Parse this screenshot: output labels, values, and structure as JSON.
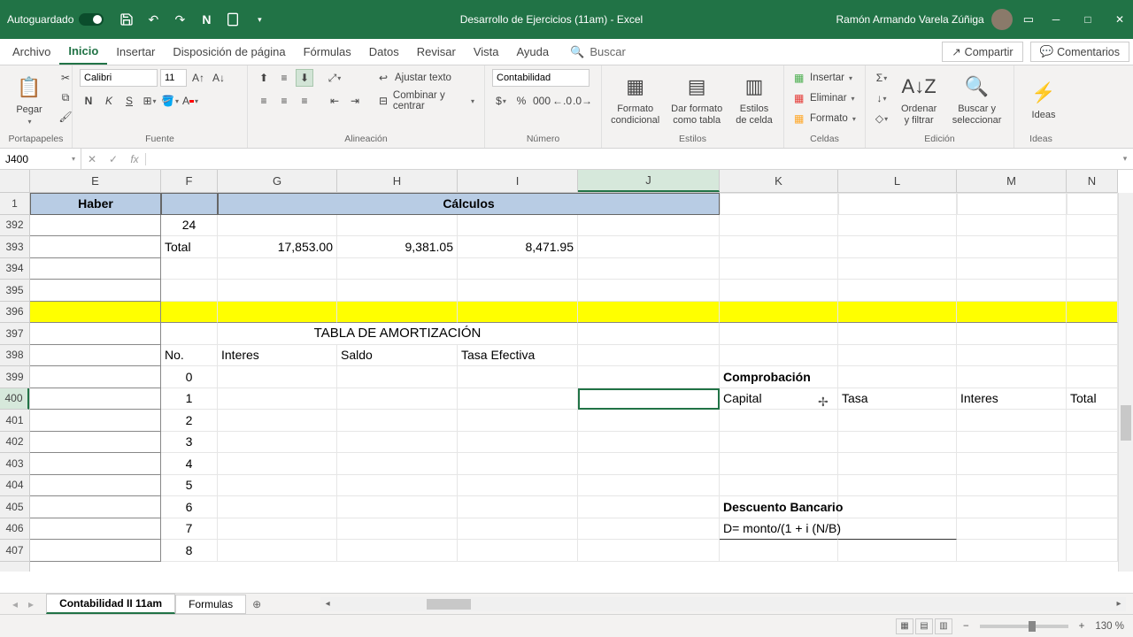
{
  "titlebar": {
    "autosave": "Autoguardado",
    "document": "Desarrollo de Ejercicios (11am)  -  Excel",
    "user": "Ramón Armando Varela Zúñiga"
  },
  "tabs": {
    "items": [
      "Archivo",
      "Inicio",
      "Insertar",
      "Disposición de página",
      "Fórmulas",
      "Datos",
      "Revisar",
      "Vista",
      "Ayuda"
    ],
    "active_index": 1,
    "search": "Buscar",
    "share": "Compartir",
    "comments": "Comentarios"
  },
  "ribbon": {
    "clipboard": {
      "paste": "Pegar",
      "label": "Portapapeles"
    },
    "font": {
      "name": "Calibri",
      "size": "11",
      "label": "Fuente"
    },
    "alignment": {
      "wrap": "Ajustar texto",
      "merge": "Combinar y centrar",
      "label": "Alineación"
    },
    "number": {
      "format": "Contabilidad",
      "label": "Número"
    },
    "styles": {
      "cond": "Formato condicional",
      "table": "Dar formato como tabla",
      "cell": "Estilos de celda",
      "label": "Estilos"
    },
    "cells": {
      "insert": "Insertar",
      "delete": "Eliminar",
      "format": "Formato",
      "label": "Celdas"
    },
    "editing": {
      "sort": "Ordenar y filtrar",
      "find": "Buscar y seleccionar",
      "label": "Edición"
    },
    "ideas": {
      "btn": "Ideas",
      "label": "Ideas"
    }
  },
  "fx": {
    "cell_ref": "J400",
    "formula": ""
  },
  "columns": [
    {
      "id": "E",
      "w": 148
    },
    {
      "id": "F",
      "w": 64
    },
    {
      "id": "G",
      "w": 135
    },
    {
      "id": "H",
      "w": 136
    },
    {
      "id": "I",
      "w": 136
    },
    {
      "id": "J",
      "w": 160
    },
    {
      "id": "K",
      "w": 134
    },
    {
      "id": "L",
      "w": 134
    },
    {
      "id": "M",
      "w": 124
    },
    {
      "id": "N",
      "w": 58
    }
  ],
  "sel_col": "J",
  "rows": [
    "1",
    "392",
    "393",
    "394",
    "395",
    "396",
    "397",
    "398",
    "399",
    "400",
    "401",
    "402",
    "403",
    "404",
    "405",
    "406",
    "407"
  ],
  "sel_row": "400",
  "grid": {
    "header_e": "Haber",
    "header_calc": "Cálculos",
    "r392": {
      "F": "24"
    },
    "r393": {
      "F": "Total",
      "G": "17,853.00",
      "H": "9,381.05",
      "I": "8,471.95"
    },
    "r397": {
      "title": "TABLA DE AMORTIZACIÓN"
    },
    "r398": {
      "F": "No.",
      "G": "Interes",
      "H": "Saldo",
      "I": "Tasa Efectiva"
    },
    "r399": {
      "F": "0",
      "K": "Comprobación"
    },
    "r400": {
      "F": "1",
      "K": "Capital",
      "L": "Tasa",
      "M": "Interes",
      "N": "Total"
    },
    "r401": {
      "F": "2"
    },
    "r402": {
      "F": "3"
    },
    "r403": {
      "F": "4"
    },
    "r404": {
      "F": "5"
    },
    "r405": {
      "F": "6",
      "K": "Descuento Bancario"
    },
    "r406": {
      "F": "7",
      "K": "D= monto/(1 + i (N/B)"
    },
    "r407": {
      "F": "8"
    }
  },
  "sheets": {
    "tabs": [
      "Contabilidad II 11am",
      "Formulas"
    ],
    "active": 0
  },
  "status": {
    "zoom": "130 %"
  }
}
